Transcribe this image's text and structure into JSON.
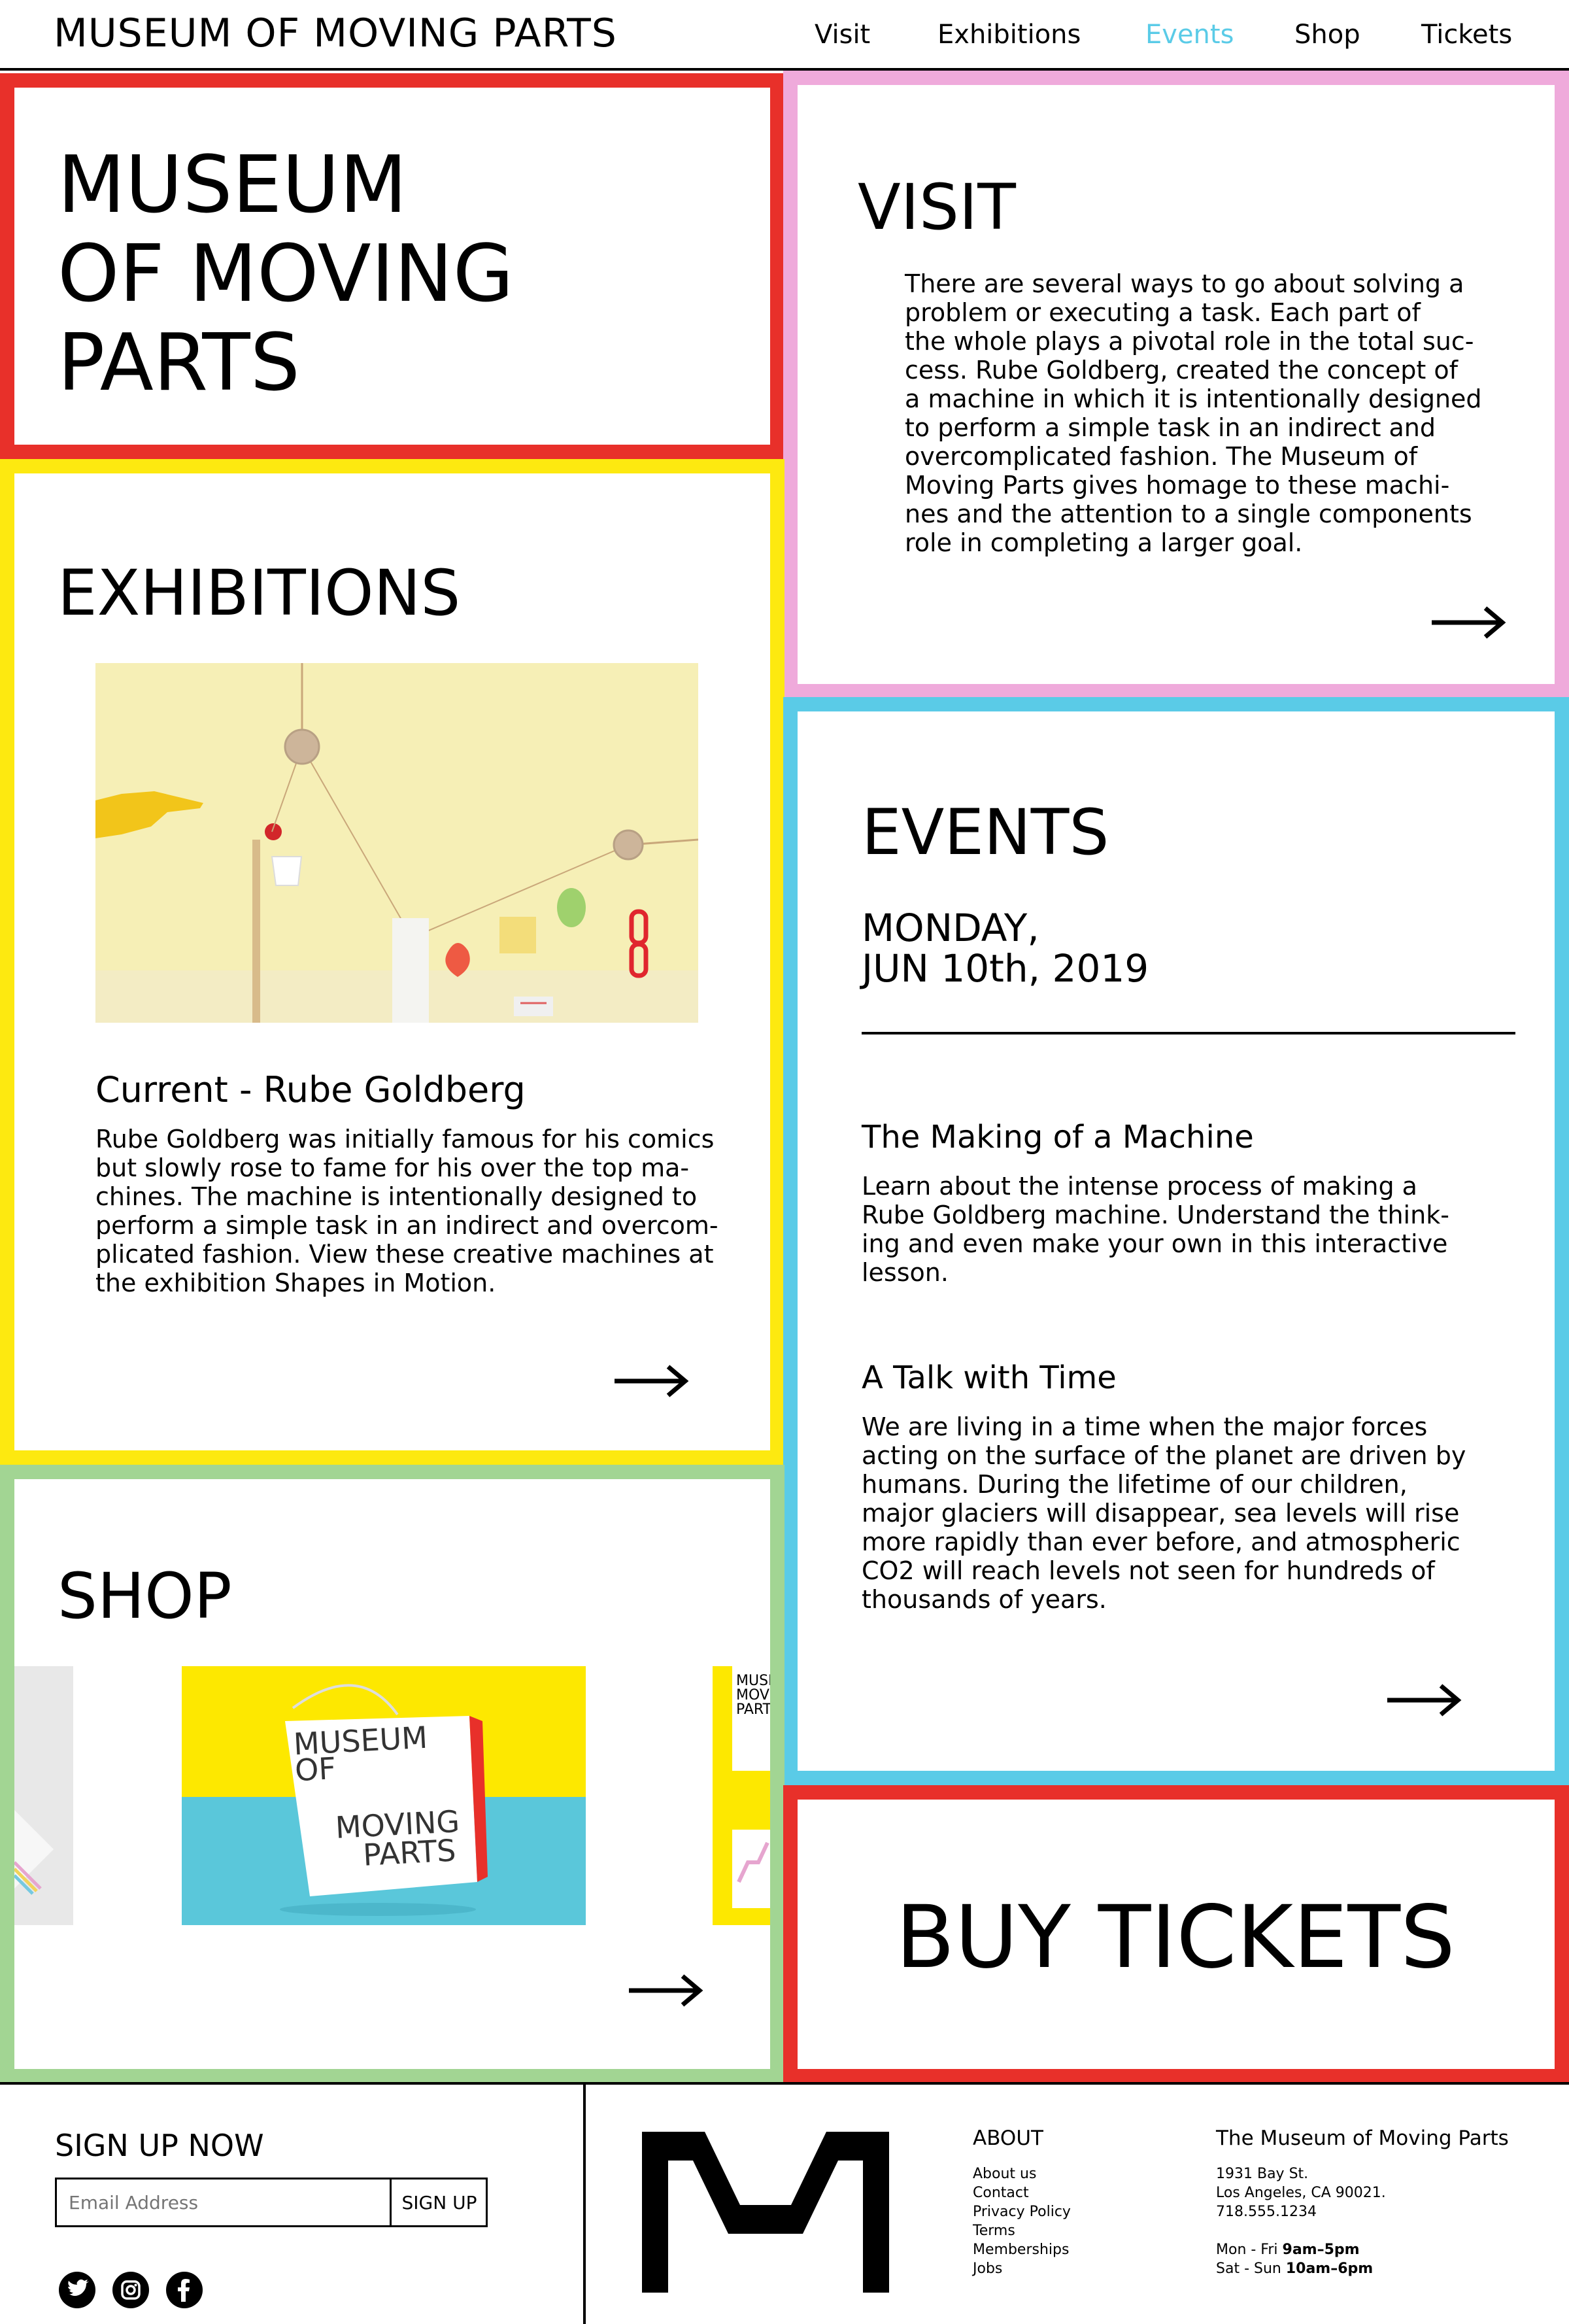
{
  "nav": {
    "brand": "MUSEUM OF MOVING PARTS",
    "links": [
      {
        "label": "Visit",
        "active": false
      },
      {
        "label": "Exhibitions",
        "active": false
      },
      {
        "label": "Events",
        "active": true
      },
      {
        "label": "Shop",
        "active": false
      },
      {
        "label": "Tickets",
        "active": false
      }
    ]
  },
  "colors": {
    "red": "#e8302a",
    "pink": "#efaadb",
    "yellow": "#fde910",
    "blue": "#5acbe7",
    "green": "#a2d593",
    "active_link": "#5acbe7"
  },
  "hero": {
    "line1": "MUSEUM",
    "line2": "OF MOVING",
    "line3": "PARTS"
  },
  "visit": {
    "title": "VISIT",
    "lines": [
      "There are several ways to go about solving a",
      "problem or executing a task. Each part of",
      "the whole plays a pivotal role in the total suc-",
      "cess. Rube Goldberg, created the concept of",
      "a machine in which it is intentionally designed",
      "to perform a simple task in an indirect and",
      "overcomplicated fashion. The Museum of",
      "Moving Parts gives homage to these machi-",
      "nes and the attention to a single components",
      "role in completing a larger goal."
    ],
    "arrow_icon": "arrow-right-icon"
  },
  "exhibitions": {
    "title": "EXHIBITIONS",
    "current_title": "Current - Rube Goldberg",
    "lines": [
      "Rube Goldberg was initially famous for his comics",
      "but slowly rose to fame for his over the top ma-",
      "chines. The machine is intentionally designed to",
      "perform a simple task in an indirect and overcom-",
      "plicated fashion. View these creative machines at",
      "the exhibition Shapes in Motion."
    ],
    "arrow_icon": "arrow-right-icon"
  },
  "events": {
    "title": "EVENTS",
    "date_line1": "MONDAY,",
    "date_line2": "JUN 10th, 2019",
    "items": [
      {
        "title": "The Making of a Machine",
        "lines": [
          "Learn about the intense process of making a",
          "Rube Goldberg machine. Understand the think-",
          "ing and even make your own in this interactive",
          "lesson."
        ]
      },
      {
        "title": "A Talk with Time",
        "lines": [
          "We are living in a time when the major forces",
          "acting on the surface of the planet are driven by",
          "humans. During the lifetime of our children,",
          "major glaciers will disappear, sea levels will rise",
          "more rapidly than ever before, and atmospheric",
          "CO2 will reach levels not seen for hundreds of",
          "thousands of years."
        ]
      }
    ],
    "arrow_icon": "arrow-right-icon"
  },
  "shop": {
    "title": "SHOP",
    "bag_text": {
      "line1": "MUSEUM",
      "line2": "OF",
      "line3": "MOVING",
      "line4": "PARTS"
    },
    "peek_text": {
      "line1": "MUSI",
      "line2": "MOVI",
      "line3": "PART"
    },
    "arrow_icon": "arrow-right-icon"
  },
  "tickets": {
    "label": "BUY TICKETS"
  },
  "footer": {
    "signup_title": "SIGN UP NOW",
    "email_placeholder": "Email Address",
    "signup_button": "SIGN UP",
    "social_icons": [
      "twitter-icon",
      "instagram-icon",
      "facebook-icon"
    ],
    "about_title": "ABOUT",
    "about_links": [
      "About us",
      "Contact",
      "Privacy Policy",
      "Terms",
      "Memberships",
      "Jobs"
    ],
    "org_name": "The Museum of Moving Parts",
    "address1": "1931 Bay St.",
    "address2": "Los Angeles, CA 90021.",
    "phone": "718.555.1234",
    "hours_weekday_label": "Mon - Fri ",
    "hours_weekday_time": "9am–5pm",
    "hours_weekend_label": "Sat - Sun ",
    "hours_weekend_time": "10am–6pm"
  }
}
